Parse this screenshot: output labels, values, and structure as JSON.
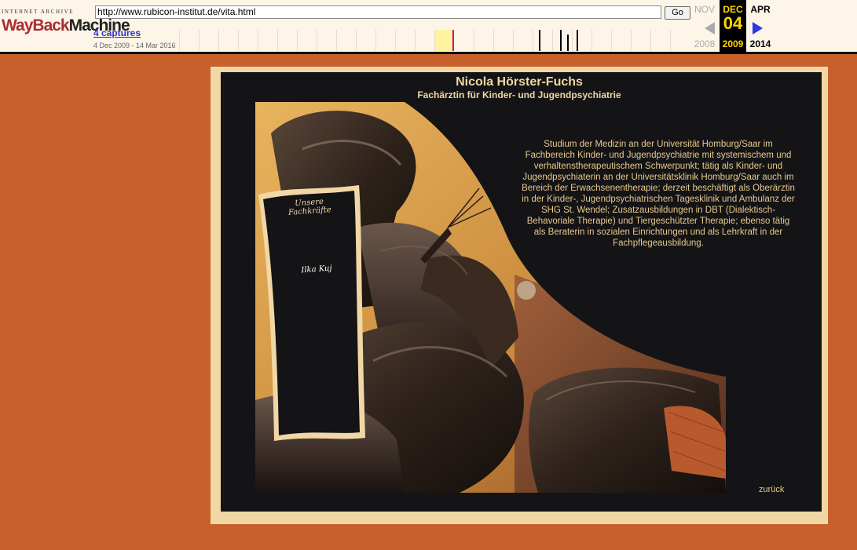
{
  "wayback": {
    "logo_top": "INTERNET ARCHIVE",
    "logo_way": "WayBack",
    "logo_machine": "Machine",
    "url": "http://www.rubicon-institut.de/vita.html",
    "go_label": "Go",
    "captures_label": "4 captures",
    "capture_range": "4 Dec 2009 - 14 Mar 2016",
    "calendar": {
      "prev": {
        "month": "NOV",
        "year": "2008"
      },
      "current": {
        "month": "DEC",
        "day": "04",
        "year": "2009"
      },
      "next": {
        "month": "APR",
        "year": "2014"
      }
    }
  },
  "page": {
    "title": "Nicola Hörster-Fuchs",
    "subtitle": "Fachärztin für Kinder- und Jugendpsychiatrie",
    "bio": "Studium der Medizin an der Universität Homburg/Saar im Fachbereich Kinder- und Jugendpsychiatrie mit systemischem und verhaltenstherapeutischem Schwerpunkt; tätig als Kinder- und Jugendpsychiaterin an der Universitätsklinik Homburg/Saar auch im Bereich der Erwachsenentherapie; derzeit beschäftigt als Oberärztin in der Kinder-, Jugendpsychiatrischen Tagesklinik und Ambulanz der SHG St. Wendel; Zusatzausbildungen in DBT (Dialektisch-Behavoriale Therapie) und Tiergeschützter Therapie; ebenso tätig als Beraterin in sozialen Einrichtungen und als Lehrkraft in der Fachpflegeausbildung.",
    "back_link": "zurück",
    "menu_panel": {
      "heading": "Unsere Fachkräfte",
      "item": "Ilka Kuj"
    }
  },
  "colors": {
    "background": "#c8602c",
    "card_cream": "#f2d7a6",
    "card_dark": "#141416",
    "text_gold": "#e8c98e",
    "wayback_red": "#ab2e33",
    "calendar_highlight": "#ffd700",
    "link_blue": "#2e33cc"
  }
}
